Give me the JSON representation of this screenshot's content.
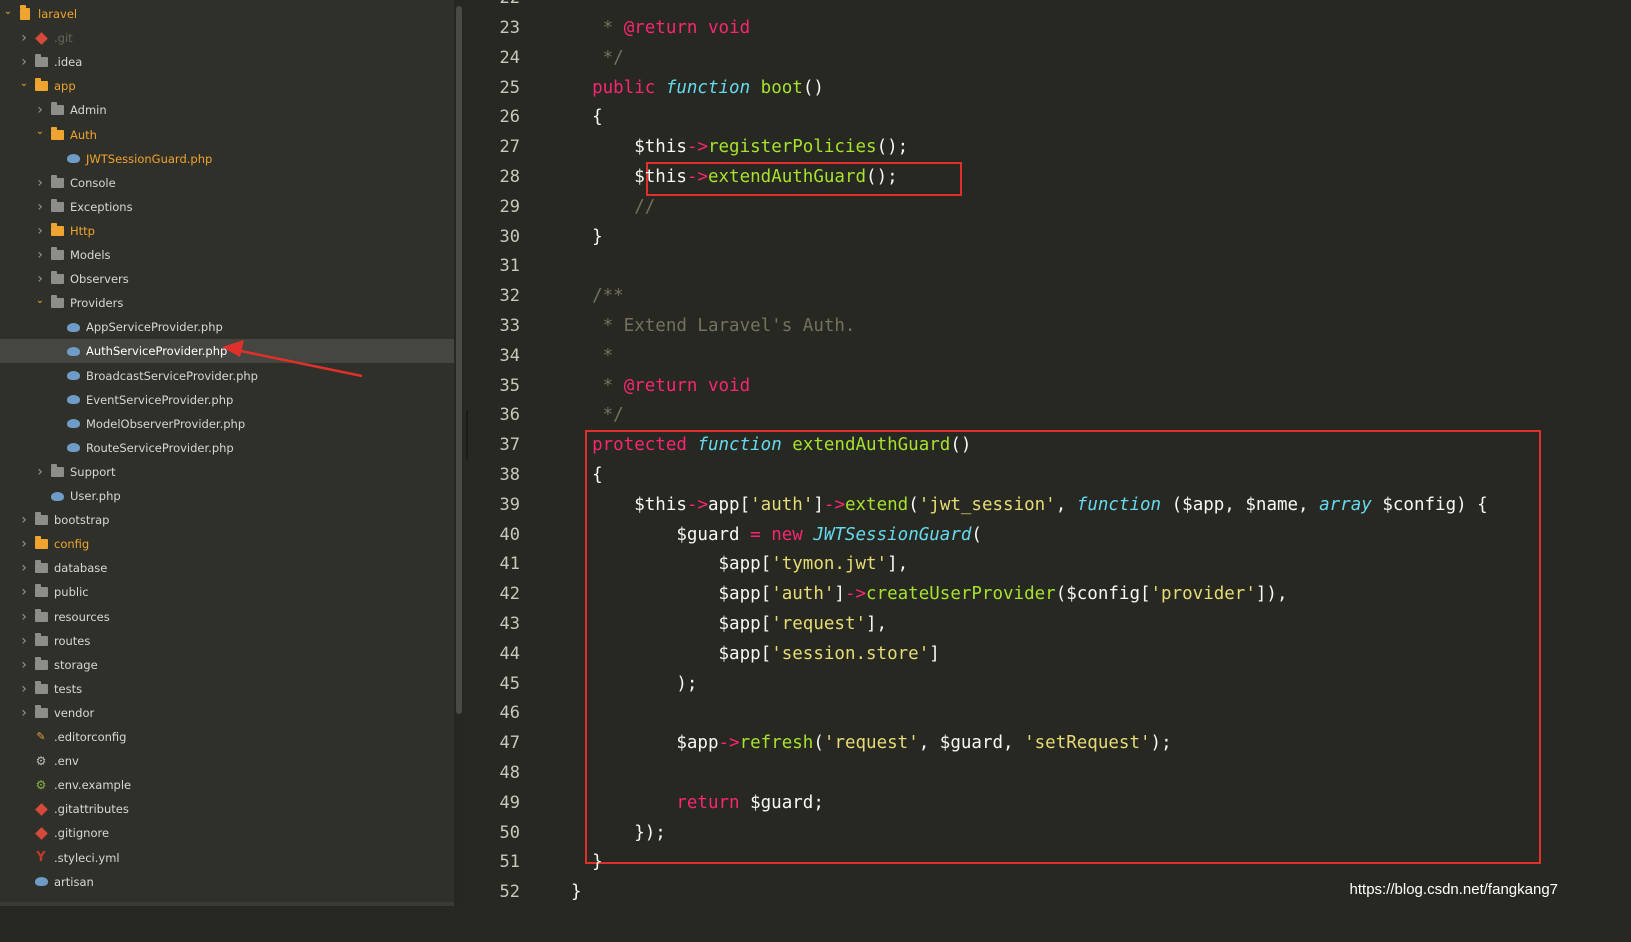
{
  "sidebar": {
    "items": [
      {
        "label": "laravel",
        "indent": 0,
        "arrow": "open",
        "icon": "project-icon",
        "color": "orange"
      },
      {
        "label": ".git",
        "indent": 1,
        "arrow": "closed",
        "icon": "git-icon",
        "color": "dim"
      },
      {
        "label": ".idea",
        "indent": 1,
        "arrow": "closed",
        "icon": "folder-icon",
        "color": "normal"
      },
      {
        "label": "app",
        "indent": 1,
        "arrow": "open",
        "icon": "folder-orange-icon",
        "color": "orange"
      },
      {
        "label": "Admin",
        "indent": 2,
        "arrow": "closed",
        "icon": "folder-icon",
        "color": "normal"
      },
      {
        "label": "Auth",
        "indent": 2,
        "arrow": "open",
        "icon": "folder-orange-icon",
        "color": "orange"
      },
      {
        "label": "JWTSessionGuard.php",
        "indent": 3,
        "arrow": "none",
        "icon": "php-icon",
        "color": "orange"
      },
      {
        "label": "Console",
        "indent": 2,
        "arrow": "closed",
        "icon": "folder-icon",
        "color": "normal"
      },
      {
        "label": "Exceptions",
        "indent": 2,
        "arrow": "closed",
        "icon": "folder-icon",
        "color": "normal"
      },
      {
        "label": "Http",
        "indent": 2,
        "arrow": "closed",
        "icon": "folder-orange-icon",
        "color": "orange"
      },
      {
        "label": "Models",
        "indent": 2,
        "arrow": "closed",
        "icon": "folder-icon",
        "color": "normal"
      },
      {
        "label": "Observers",
        "indent": 2,
        "arrow": "closed",
        "icon": "folder-icon",
        "color": "normal"
      },
      {
        "label": "Providers",
        "indent": 2,
        "arrow": "open",
        "icon": "folder-icon",
        "color": "normal"
      },
      {
        "label": "AppServiceProvider.php",
        "indent": 3,
        "arrow": "none",
        "icon": "php-icon",
        "color": "normal"
      },
      {
        "label": "AuthServiceProvider.php",
        "indent": 3,
        "arrow": "none",
        "icon": "php-icon",
        "color": "selected"
      },
      {
        "label": "BroadcastServiceProvider.php",
        "indent": 3,
        "arrow": "none",
        "icon": "php-icon",
        "color": "normal"
      },
      {
        "label": "EventServiceProvider.php",
        "indent": 3,
        "arrow": "none",
        "icon": "php-icon",
        "color": "normal"
      },
      {
        "label": "ModelObserverProvider.php",
        "indent": 3,
        "arrow": "none",
        "icon": "php-icon",
        "color": "normal"
      },
      {
        "label": "RouteServiceProvider.php",
        "indent": 3,
        "arrow": "none",
        "icon": "php-icon",
        "color": "normal"
      },
      {
        "label": "Support",
        "indent": 2,
        "arrow": "closed",
        "icon": "folder-icon",
        "color": "normal"
      },
      {
        "label": "User.php",
        "indent": 2,
        "arrow": "none",
        "icon": "php-icon",
        "color": "normal"
      },
      {
        "label": "bootstrap",
        "indent": 1,
        "arrow": "closed",
        "icon": "folder-icon",
        "color": "normal"
      },
      {
        "label": "config",
        "indent": 1,
        "arrow": "closed",
        "icon": "folder-orange-icon",
        "color": "orange"
      },
      {
        "label": "database",
        "indent": 1,
        "arrow": "closed",
        "icon": "folder-icon",
        "color": "normal"
      },
      {
        "label": "public",
        "indent": 1,
        "arrow": "closed",
        "icon": "folder-icon",
        "color": "normal"
      },
      {
        "label": "resources",
        "indent": 1,
        "arrow": "closed",
        "icon": "folder-icon",
        "color": "normal"
      },
      {
        "label": "routes",
        "indent": 1,
        "arrow": "closed",
        "icon": "folder-icon",
        "color": "normal"
      },
      {
        "label": "storage",
        "indent": 1,
        "arrow": "closed",
        "icon": "folder-icon",
        "color": "normal"
      },
      {
        "label": "tests",
        "indent": 1,
        "arrow": "closed",
        "icon": "folder-icon",
        "color": "normal"
      },
      {
        "label": "vendor",
        "indent": 1,
        "arrow": "closed",
        "icon": "folder-icon",
        "color": "normal"
      },
      {
        "label": ".editorconfig",
        "indent": 1,
        "arrow": "none",
        "icon": "editorconfig-icon",
        "color": "normal"
      },
      {
        "label": ".env",
        "indent": 1,
        "arrow": "none",
        "icon": "gear-icon",
        "color": "normal"
      },
      {
        "label": ".env.example",
        "indent": 1,
        "arrow": "none",
        "icon": "gear-green-icon",
        "color": "normal"
      },
      {
        "label": ".gitattributes",
        "indent": 1,
        "arrow": "none",
        "icon": "git-icon",
        "color": "normal"
      },
      {
        "label": ".gitignore",
        "indent": 1,
        "arrow": "none",
        "icon": "git-icon",
        "color": "normal"
      },
      {
        "label": ".styleci.yml",
        "indent": 1,
        "arrow": "none",
        "icon": "yaml-icon",
        "color": "normal"
      },
      {
        "label": "artisan",
        "indent": 1,
        "arrow": "none",
        "icon": "php-icon",
        "color": "normal"
      }
    ]
  },
  "editor": {
    "first_line_number": 23,
    "lines": [
      [
        [
          "cm",
          "   * "
        ],
        [
          "tg",
          "@return"
        ],
        [
          "cm",
          " "
        ],
        [
          "kw",
          "void"
        ]
      ],
      [
        [
          "cm",
          "   */"
        ]
      ],
      [
        [
          "kw",
          "  public "
        ],
        [
          "fn",
          "function"
        ],
        [
          "txt",
          " "
        ],
        [
          "nm",
          "boot"
        ],
        [
          "txt",
          "()"
        ]
      ],
      [
        [
          "txt",
          "  {"
        ]
      ],
      [
        [
          "txt",
          "      $this"
        ],
        [
          "op",
          "->"
        ],
        [
          "nm",
          "registerPolicies"
        ],
        [
          "txt",
          "();"
        ]
      ],
      [
        [
          "txt",
          "      $this"
        ],
        [
          "op",
          "->"
        ],
        [
          "nm",
          "extendAuthGuard"
        ],
        [
          "txt",
          "();"
        ]
      ],
      [
        [
          "cm",
          "      //"
        ]
      ],
      [
        [
          "txt",
          "  }"
        ]
      ],
      [
        [
          "txt",
          ""
        ]
      ],
      [
        [
          "cm",
          "  /**"
        ]
      ],
      [
        [
          "cm",
          "   * Extend Laravel's Auth."
        ]
      ],
      [
        [
          "cm",
          "   *"
        ]
      ],
      [
        [
          "cm",
          "   * "
        ],
        [
          "tg",
          "@return"
        ],
        [
          "cm",
          " "
        ],
        [
          "kw",
          "void"
        ]
      ],
      [
        [
          "cm",
          "   */"
        ]
      ],
      [
        [
          "kw",
          "  protected "
        ],
        [
          "fn",
          "function"
        ],
        [
          "txt",
          " "
        ],
        [
          "nm",
          "extendAuthGuard"
        ],
        [
          "txt",
          "()"
        ]
      ],
      [
        [
          "txt",
          "  {"
        ]
      ],
      [
        [
          "txt",
          "      $this"
        ],
        [
          "op",
          "->"
        ],
        [
          "txt",
          "app["
        ],
        [
          "str",
          "'auth'"
        ],
        [
          "txt",
          "]"
        ],
        [
          "op",
          "->"
        ],
        [
          "nm",
          "extend"
        ],
        [
          "txt",
          "("
        ],
        [
          "str",
          "'jwt_session'"
        ],
        [
          "txt",
          ", "
        ],
        [
          "fn",
          "function"
        ],
        [
          "txt",
          " ($app, $name, "
        ],
        [
          "fn",
          "array"
        ],
        [
          "txt",
          " $config) {"
        ]
      ],
      [
        [
          "txt",
          "          $guard "
        ],
        [
          "op",
          "="
        ],
        [
          "txt",
          " "
        ],
        [
          "kw",
          "new"
        ],
        [
          "txt",
          " "
        ],
        [
          "cls",
          "JWTSessionGuard"
        ],
        [
          "txt",
          "("
        ]
      ],
      [
        [
          "txt",
          "              $app["
        ],
        [
          "str",
          "'tymon.jwt'"
        ],
        [
          "txt",
          "],"
        ]
      ],
      [
        [
          "txt",
          "              $app["
        ],
        [
          "str",
          "'auth'"
        ],
        [
          "txt",
          "]"
        ],
        [
          "op",
          "->"
        ],
        [
          "nm",
          "createUserProvider"
        ],
        [
          "txt",
          "($config["
        ],
        [
          "str",
          "'provider'"
        ],
        [
          "txt",
          "]),"
        ]
      ],
      [
        [
          "txt",
          "              $app["
        ],
        [
          "str",
          "'request'"
        ],
        [
          "txt",
          "],"
        ]
      ],
      [
        [
          "txt",
          "              $app["
        ],
        [
          "str",
          "'session.store'"
        ],
        [
          "txt",
          "]"
        ]
      ],
      [
        [
          "txt",
          "          );"
        ]
      ],
      [
        [
          "txt",
          ""
        ]
      ],
      [
        [
          "txt",
          "          $app"
        ],
        [
          "op",
          "->"
        ],
        [
          "nm",
          "refresh"
        ],
        [
          "txt",
          "("
        ],
        [
          "str",
          "'request'"
        ],
        [
          "txt",
          ", $guard, "
        ],
        [
          "str",
          "'setRequest'"
        ],
        [
          "txt",
          ");"
        ]
      ],
      [
        [
          "txt",
          ""
        ]
      ],
      [
        [
          "kw",
          "          return"
        ],
        [
          "txt",
          " $guard;"
        ]
      ],
      [
        [
          "txt",
          "      });"
        ]
      ],
      [
        [
          "txt",
          "  }"
        ]
      ],
      [
        [
          "txt",
          "}"
        ]
      ]
    ]
  },
  "colors": {
    "keyword": "#f92672",
    "function": "#66d9ef",
    "name": "#a6e22e",
    "string": "#e6db74",
    "comment": "#75715e",
    "highlight_box": "#e0302c",
    "folder_open": "#f0a430"
  },
  "watermark": "https://blog.csdn.net/fangkang7"
}
